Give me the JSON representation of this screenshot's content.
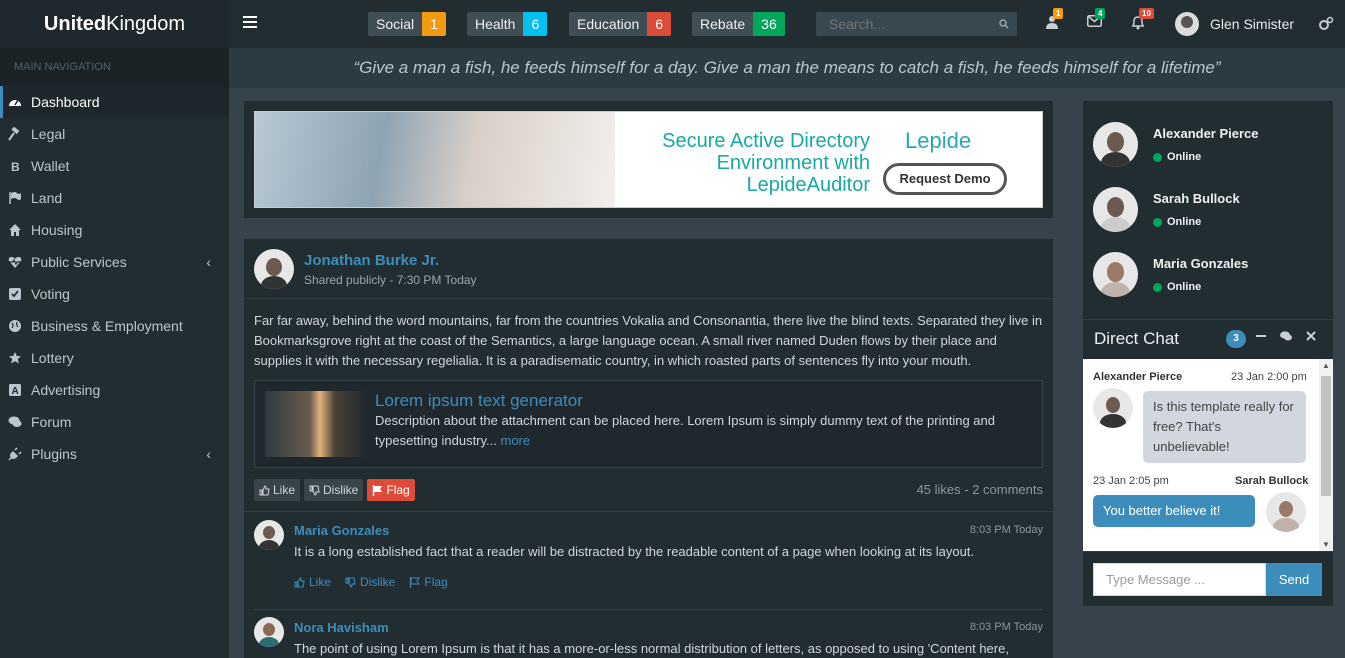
{
  "brand": {
    "bold": "United",
    "rest": "Kingdom"
  },
  "header": {
    "tags": [
      {
        "label": "Social",
        "count": "1",
        "color": "#f39c12"
      },
      {
        "label": "Health",
        "count": "6",
        "color": "#00c0ef"
      },
      {
        "label": "Education",
        "count": "6",
        "color": "#dd4b39"
      },
      {
        "label": "Rebate",
        "count": "36",
        "color": "#00a65a"
      }
    ],
    "search_placeholder": "Search...",
    "notifications": [
      {
        "icon": "user-icon",
        "count": "1",
        "color": "#f39c12"
      },
      {
        "icon": "envelope-icon",
        "count": "4",
        "color": "#00a65a"
      },
      {
        "icon": "bell-icon",
        "count": "10",
        "color": "#dd4b39"
      }
    ],
    "user_name": "Glen Simister"
  },
  "sidebar": {
    "header": "MAIN NAVIGATION",
    "items": [
      {
        "label": "Dashboard",
        "icon": "dashboard-icon"
      },
      {
        "label": "Legal",
        "icon": "gavel-icon"
      },
      {
        "label": "Wallet",
        "icon": "bitcoin-icon"
      },
      {
        "label": "Land",
        "icon": "flag-icon"
      },
      {
        "label": "Housing",
        "icon": "home-icon"
      },
      {
        "label": "Public Services",
        "icon": "heartbeat-icon"
      },
      {
        "label": "Voting",
        "icon": "check-square-icon"
      },
      {
        "label": "Business & Employment",
        "icon": "globe-icon"
      },
      {
        "label": "Lottery",
        "icon": "star-icon"
      },
      {
        "label": "Advertising",
        "icon": "advertising-icon"
      },
      {
        "label": "Forum",
        "icon": "comments-icon"
      },
      {
        "label": "Plugins",
        "icon": "plug-icon"
      }
    ]
  },
  "quote": "“Give a man a fish, he feeds himself for a day. Give a man the means to catch a fish, he feeds himself for a lifetime”",
  "ad": {
    "headline": "Secure Active Directory Environment with LepideAuditor",
    "logo": "Lepide",
    "button": "Request Demo"
  },
  "post": {
    "author": "Jonathan Burke Jr.",
    "meta": "Shared publicly - 7:30 PM Today",
    "text": "Far far away, behind the word mountains, far from the countries Vokalia and Consonantia, there live the blind texts. Separated they live in Bookmarksgrove right at the coast of the Semantics, a large language ocean. A small river named Duden flows by their place and supplies it with the necessary regelialia. It is a paradisematic country, in which roasted parts of sentences fly into your mouth.",
    "attachment": {
      "title": "Lorem ipsum text generator",
      "description": "Description about the attachment can be placed here. Lorem Ipsum is simply dummy text of the printing and typesetting industry...",
      "more": "more"
    },
    "actions": {
      "like": "Like",
      "dislike": "Dislike",
      "flag": "Flag"
    },
    "stats": "45 likes - 2 comments",
    "comments": [
      {
        "name": "Maria Gonzales",
        "time": "8:03 PM Today",
        "text": "It is a long established fact that a reader will be distracted by the readable content of a page when looking at its layout.",
        "like": "Like",
        "dislike": "Dislike",
        "flag": "Flag"
      },
      {
        "name": "Nora Havisham",
        "time": "8:03 PM Today",
        "text": "The point of using Lorem Ipsum is that it has a more-or-less normal distribution of letters, as opposed to using 'Content here,"
      }
    ]
  },
  "users": [
    {
      "name": "Alexander Pierce",
      "status": "Online"
    },
    {
      "name": "Sarah Bullock",
      "status": "Online"
    },
    {
      "name": "Maria Gonzales",
      "status": "Online"
    }
  ],
  "chat": {
    "title": "Direct Chat",
    "badge": "3",
    "messages": [
      {
        "name": "Alexander Pierce",
        "time": "23 Jan 2:00 pm",
        "text": "Is this template really for free? That's unbelievable!"
      },
      {
        "name": "Sarah Bullock",
        "time": "23 Jan 2:05 pm",
        "text": "You better believe it!"
      }
    ],
    "input_placeholder": "Type Message ...",
    "send": "Send"
  }
}
